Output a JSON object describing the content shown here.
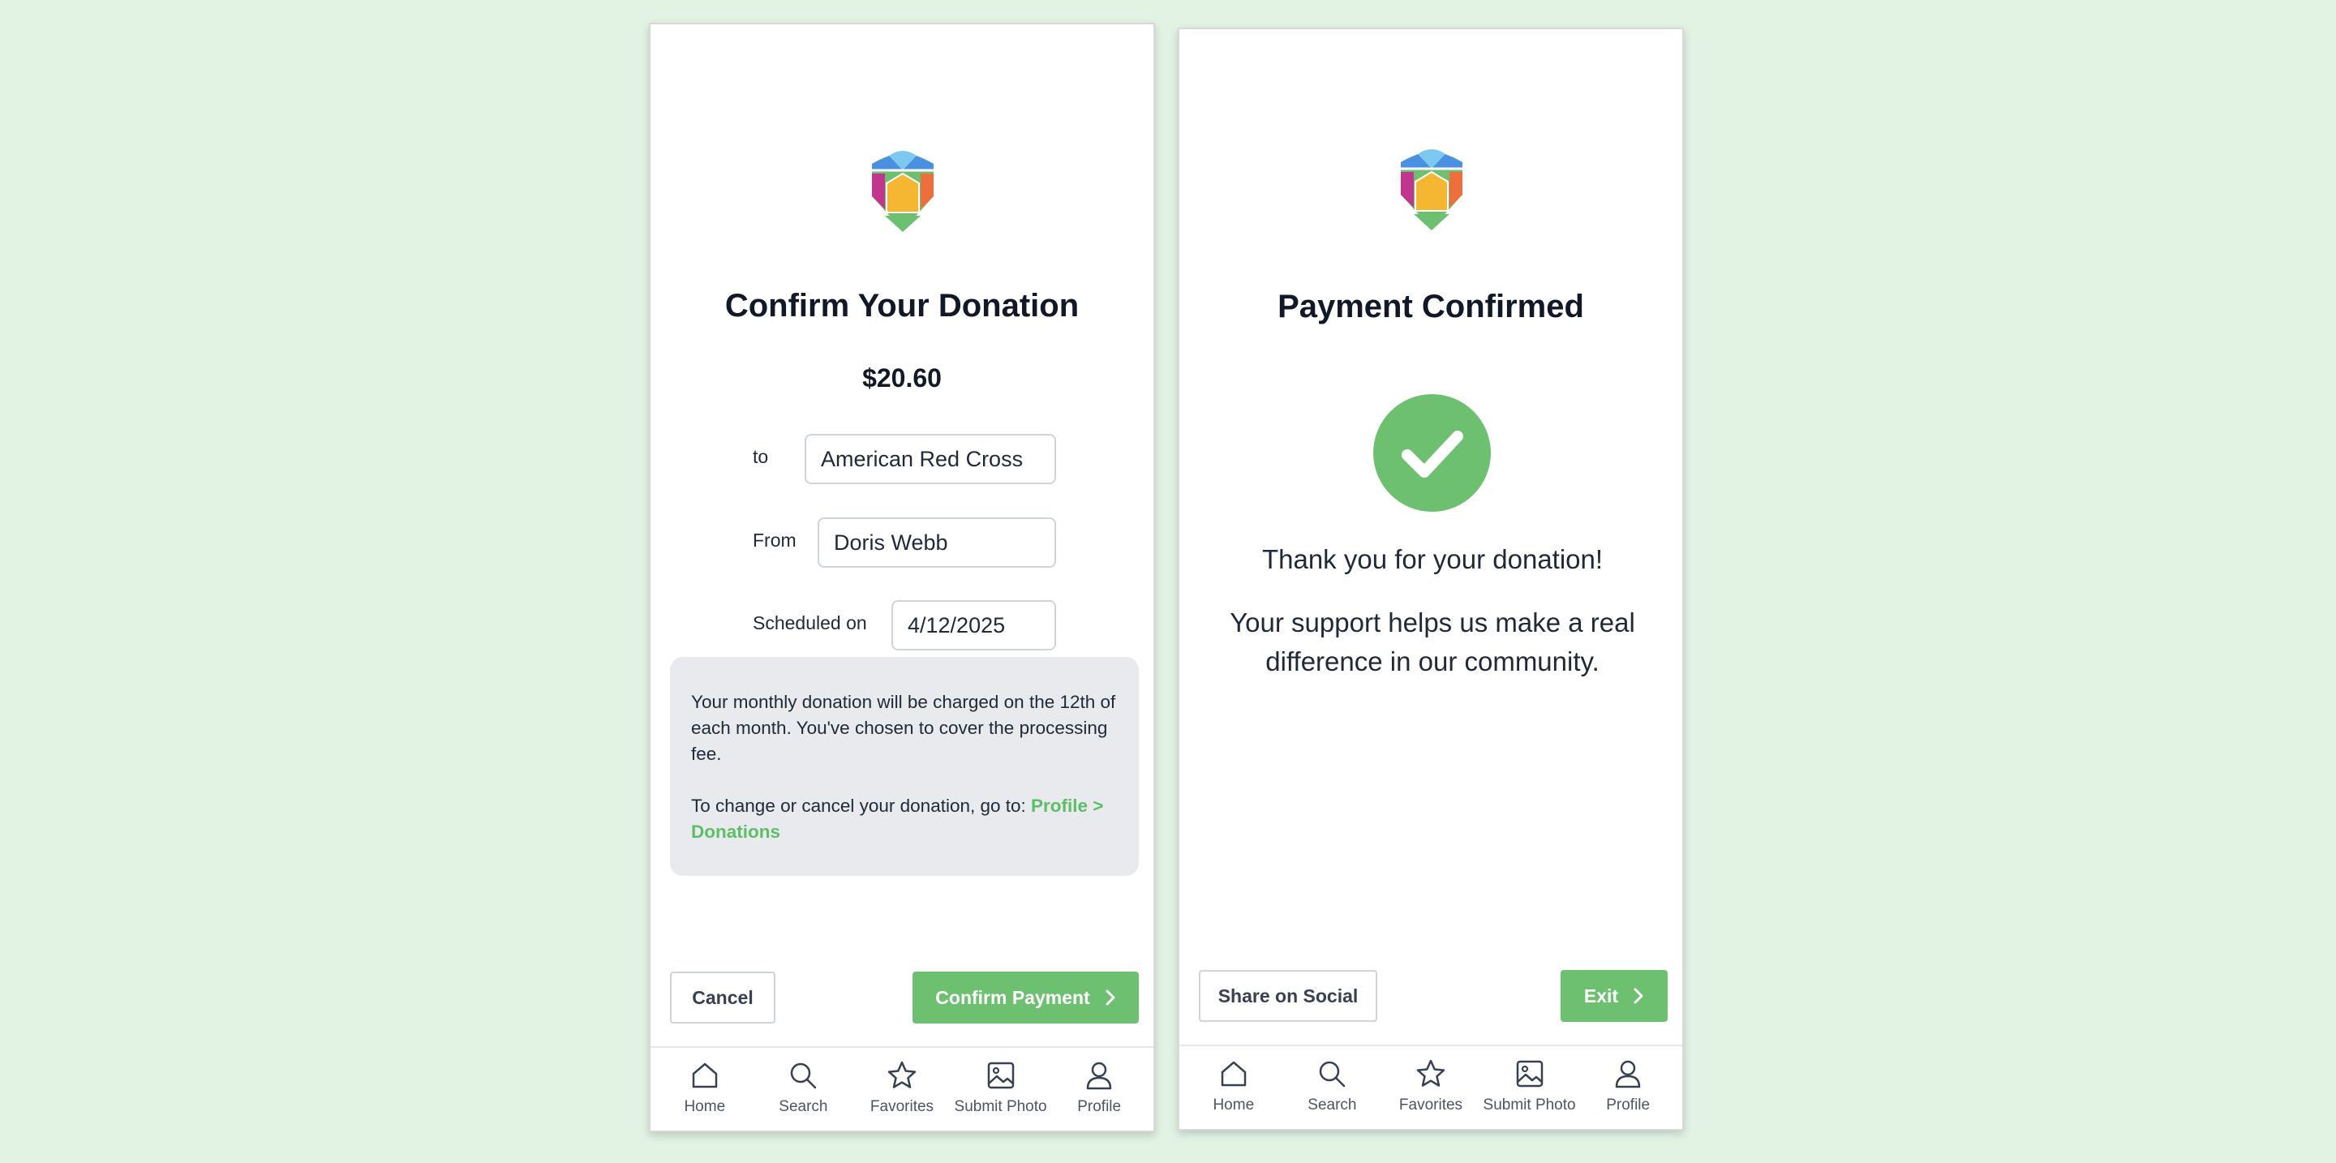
{
  "confirm_screen": {
    "title": "Confirm Your Donation",
    "amount": "$20.60",
    "to_label": "to",
    "to_value": "American Red Cross",
    "from_label": "From",
    "from_value": "Doris Webb",
    "scheduled_label": "Scheduled on",
    "scheduled_value": "4/12/2025",
    "info_text": "Your monthly donation will be charged on the 12th of each month. You've chosen to cover the processing fee.",
    "change_text": "To change or cancel your donation, go to: ",
    "change_link": "Profile > Donations",
    "cancel_label": "Cancel",
    "confirm_label": "Confirm Payment"
  },
  "success_screen": {
    "title": "Payment Confirmed",
    "thanks": "Thank you for your donation!",
    "support": "Your support helps us make a real difference in our community.",
    "share_label": "Share on Social",
    "exit_label": "Exit"
  },
  "nav": {
    "items": [
      {
        "label": "Home",
        "icon": "home-icon"
      },
      {
        "label": "Search",
        "icon": "search-icon"
      },
      {
        "label": "Favorites",
        "icon": "star-icon"
      },
      {
        "label": "Submit Photo",
        "icon": "image-icon"
      },
      {
        "label": "Profile",
        "icon": "user-icon"
      }
    ]
  },
  "colors": {
    "accent": "#6cc070",
    "link": "#5dbe68",
    "background": "#e2f3e4",
    "info_box": "#e8eaed"
  }
}
